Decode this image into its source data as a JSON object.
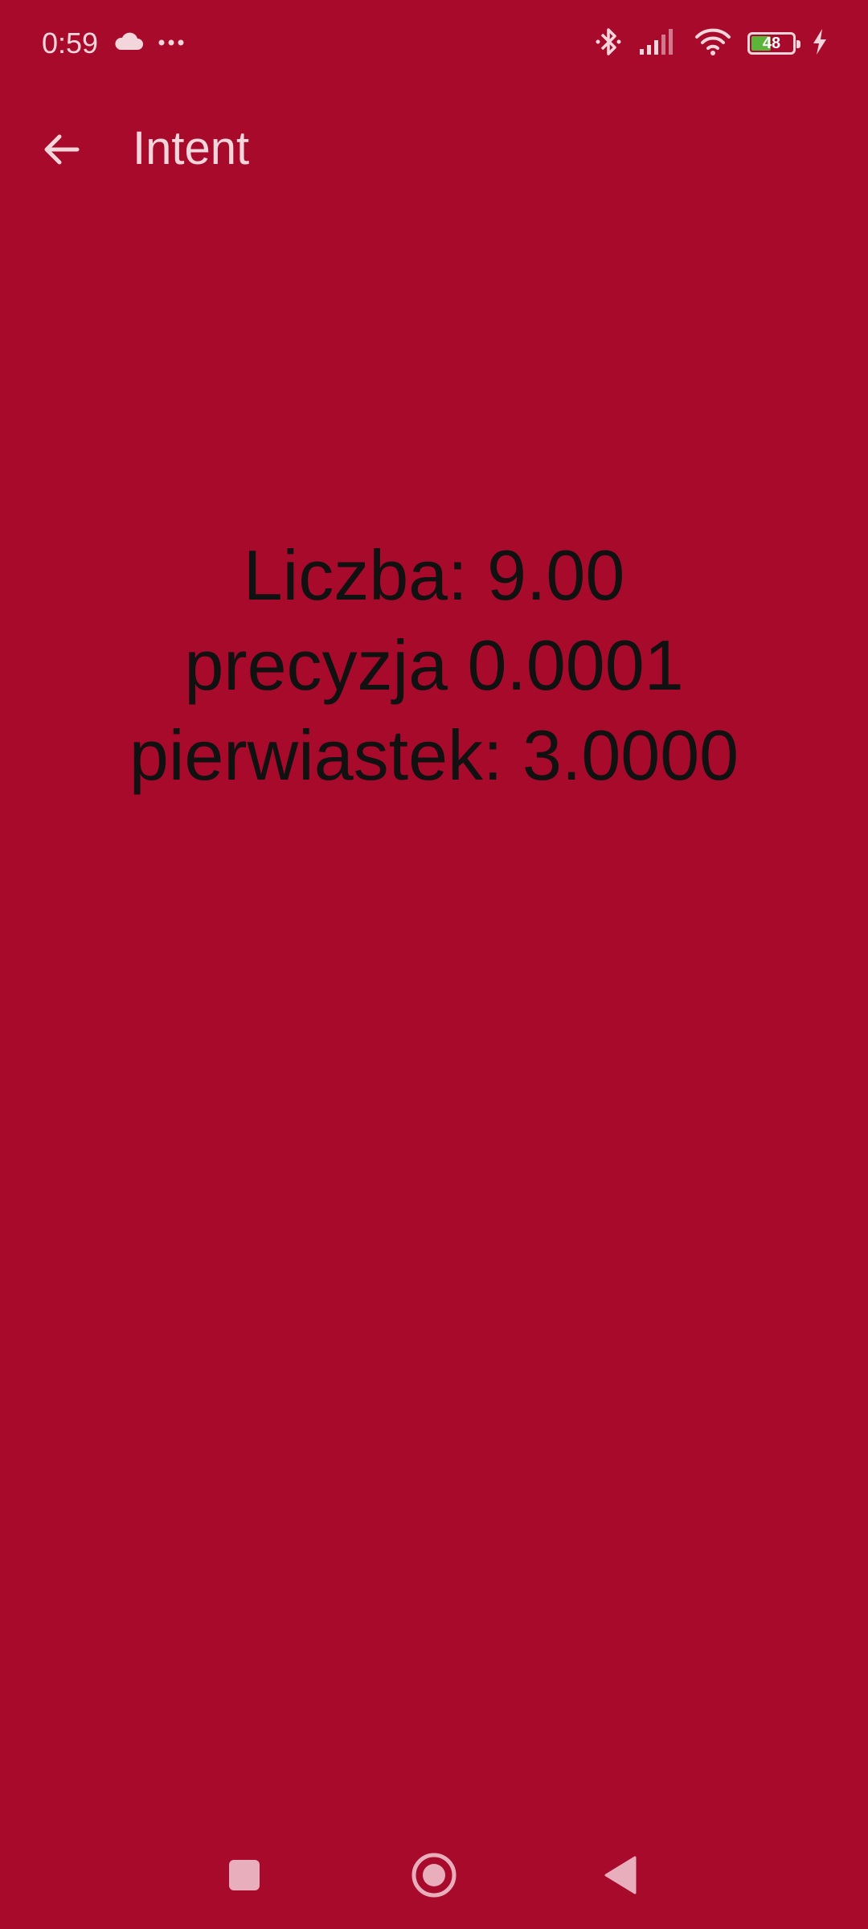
{
  "status_bar": {
    "time": "0:59",
    "left_icons": [
      "cloud-icon",
      "more-dots-icon"
    ],
    "right_icons": [
      "bluetooth-icon",
      "signal-icon",
      "wifi-icon",
      "battery-icon",
      "charging-icon"
    ],
    "battery_level": "48",
    "battery_fill_fraction": 0.48
  },
  "app_bar": {
    "back_icon": "arrow-back-icon",
    "title": "Intent"
  },
  "content": {
    "number_line": "Liczba: 9.00",
    "precision_line": "precyzja 0.0001",
    "root_line": "pierwiastek: 3.0000"
  },
  "nav_bar": {
    "icons": [
      "recents-square-icon",
      "home-circle-icon",
      "back-triangle-icon"
    ]
  },
  "colors": {
    "background": "#A80A2B",
    "foreground_light": "#F3D6DC",
    "text_dark": "#111111",
    "battery_fill": "#5BB53A"
  }
}
